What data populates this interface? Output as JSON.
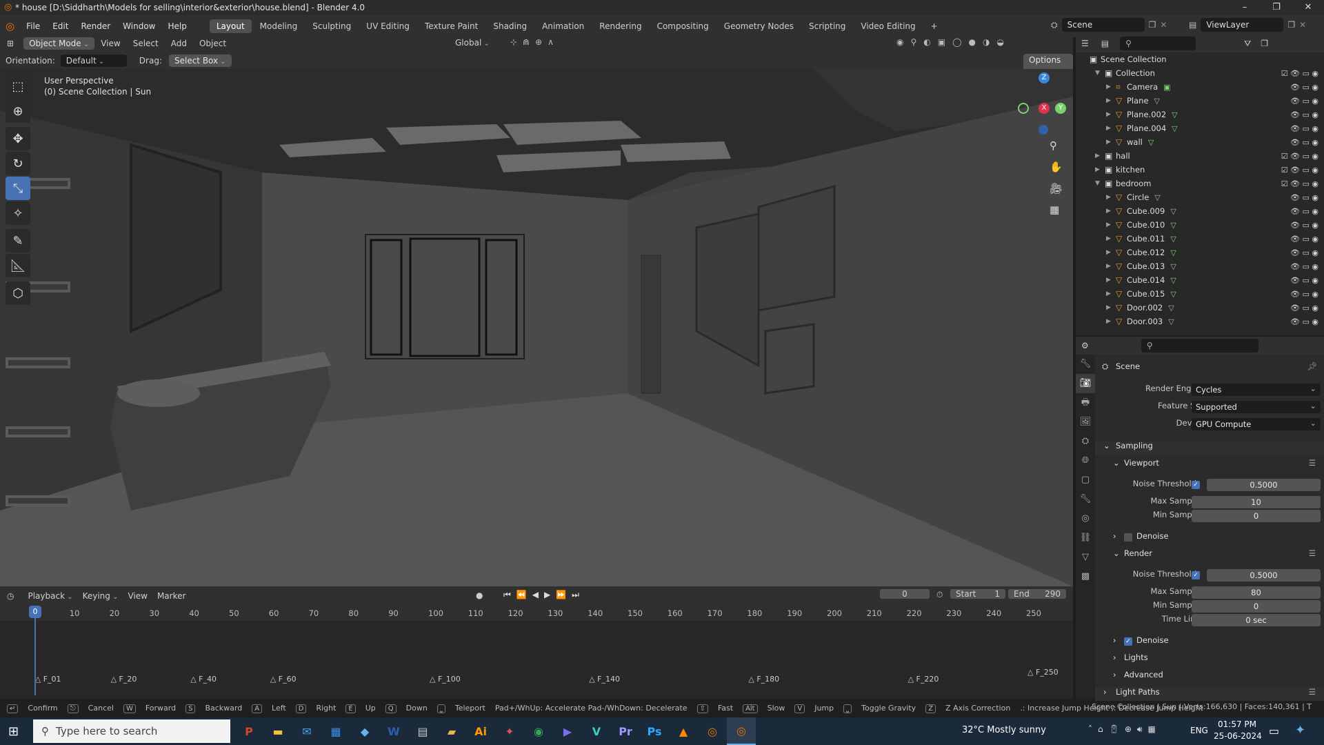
{
  "window": {
    "title": "* house [D:\\Siddharth\\Models for selling\\interior&exterior\\house.blend] - Blender 4.0",
    "controls": [
      "–",
      "❐",
      "✕"
    ]
  },
  "menu": {
    "items": [
      "File",
      "Edit",
      "Render",
      "Window",
      "Help"
    ],
    "workspaces": [
      "Layout",
      "Modeling",
      "Sculpting",
      "UV Editing",
      "Texture Paint",
      "Shading",
      "Animation",
      "Rendering",
      "Compositing",
      "Geometry Nodes",
      "Scripting",
      "Video Editing"
    ],
    "active_workspace": "Layout",
    "plus": "+",
    "scene_name": "Scene",
    "view_layer": "ViewLayer"
  },
  "viewport_header": {
    "mode": "Object Mode",
    "menus": [
      "View",
      "Select",
      "Add",
      "Object"
    ],
    "transform": "Global",
    "orientation_label": "Orientation:",
    "orientation_value": "Default",
    "drag_label": "Drag:",
    "drag_value": "Select Box",
    "options": "Options"
  },
  "viewport": {
    "perspective": "User Perspective",
    "collection_info": "(0) Scene Collection | Sun",
    "gizmo_axes": [
      "Z",
      "X",
      "Y"
    ],
    "colors": {
      "bg": "#3d3d3d",
      "x_axis": "#e0334d",
      "y_axis": "#7bd36f",
      "z_axis": "#3a87e0"
    }
  },
  "timeline": {
    "menus": [
      "Playback",
      "Keying",
      "View",
      "Marker"
    ],
    "current_frame": "0",
    "start_label": "Start",
    "start": "1",
    "end_label": "End",
    "end": "290",
    "ruler": [
      "0",
      "10",
      "20",
      "30",
      "40",
      "50",
      "60",
      "70",
      "80",
      "90",
      "100",
      "110",
      "120",
      "130",
      "140",
      "150",
      "160",
      "170",
      "180",
      "190",
      "200",
      "210",
      "220",
      "230",
      "240",
      "250"
    ],
    "markers": [
      "F_01",
      "F_20",
      "F_40",
      "F_60",
      "F_100",
      "F_140",
      "F_180",
      "F_220",
      "F_250"
    ]
  },
  "statusbar": {
    "hints": [
      {
        "key": "↵",
        "label": "Confirm"
      },
      {
        "key": "⎋",
        "label": "Cancel"
      },
      {
        "key": "W",
        "label": "Forward"
      },
      {
        "key": "S",
        "label": "Backward"
      },
      {
        "key": "A",
        "label": "Left"
      },
      {
        "key": "D",
        "label": "Right"
      },
      {
        "key": "E",
        "label": "Up"
      },
      {
        "key": "Q",
        "label": "Down"
      },
      {
        "key": "⎵",
        "label": "Teleport"
      }
    ],
    "extra": "Pad+/WhUp: Accelerate  Pad-/WhDown: Decelerate",
    "hints2": [
      {
        "key": "⇧",
        "label": "Fast"
      },
      {
        "key": "Alt",
        "label": "Slow"
      },
      {
        "key": "V",
        "label": "Jump"
      },
      {
        "key": "⎵",
        "label": "Toggle Gravity"
      },
      {
        "key": "Z",
        "label": "Z Axis Correction"
      }
    ],
    "jump": ".: Increase Jump Height  ,: Decrease Jump Height",
    "stats": "Scene Collection | Sun | Verts:166,630 | Faces:140,361 | T"
  },
  "outliner": {
    "root": "Scene Collection",
    "rows": [
      {
        "name": "Collection",
        "type": "collection",
        "depth": 1,
        "expanded": true
      },
      {
        "name": "Camera",
        "type": "camera",
        "depth": 2
      },
      {
        "name": "Plane",
        "type": "mesh",
        "depth": 2
      },
      {
        "name": "Plane.002",
        "type": "mesh",
        "depth": 2
      },
      {
        "name": "Plane.004",
        "type": "mesh",
        "depth": 2
      },
      {
        "name": "wall",
        "type": "mesh",
        "depth": 2
      },
      {
        "name": "hall",
        "type": "collection",
        "depth": 1,
        "expanded": false
      },
      {
        "name": "kitchen",
        "type": "collection",
        "depth": 1,
        "expanded": false
      },
      {
        "name": "bedroom",
        "type": "collection",
        "depth": 1,
        "expanded": true
      },
      {
        "name": "Circle",
        "type": "mesh",
        "depth": 2
      },
      {
        "name": "Cube.009",
        "type": "mesh",
        "depth": 2
      },
      {
        "name": "Cube.010",
        "type": "mesh",
        "depth": 2
      },
      {
        "name": "Cube.011",
        "type": "mesh",
        "depth": 2
      },
      {
        "name": "Cube.012",
        "type": "mesh",
        "depth": 2
      },
      {
        "name": "Cube.013",
        "type": "mesh",
        "depth": 2
      },
      {
        "name": "Cube.014",
        "type": "mesh",
        "depth": 2
      },
      {
        "name": "Cube.015",
        "type": "mesh",
        "depth": 2
      },
      {
        "name": "Door.002",
        "type": "mesh",
        "depth": 2
      },
      {
        "name": "Door.003",
        "type": "mesh",
        "depth": 2
      }
    ]
  },
  "properties": {
    "title": "Scene",
    "render_engine_label": "Render Engine",
    "render_engine": "Cycles",
    "feature_set_label": "Feature Set",
    "feature_set": "Supported",
    "device_label": "Device",
    "device": "GPU Compute",
    "sampling": "Sampling",
    "viewport": "Viewport",
    "render": "Render",
    "noise_threshold_label": "Noise Threshold",
    "viewport_noise": "0.5000",
    "max_samples_label": "Max Samples",
    "viewport_max": "10",
    "min_samples_label": "Min Samples",
    "viewport_min": "0",
    "denoise": "Denoise",
    "render_noise": "0.5000",
    "render_max": "80",
    "render_min": "0",
    "time_limit_label": "Time Limit",
    "time_limit": "0 sec",
    "lights": "Lights",
    "advanced": "Advanced",
    "light_paths": "Light Paths"
  },
  "taskbar": {
    "search_placeholder": "Type here to search",
    "weather": "32°C  Mostly sunny",
    "lang": "ENG",
    "time": "01:57 PM",
    "date": "25-06-2024",
    "apps": [
      {
        "name": "powerpoint",
        "glyph": "P",
        "color": "#d24726"
      },
      {
        "name": "file-explorer",
        "glyph": "▬",
        "color": "#f3c13a"
      },
      {
        "name": "mail",
        "glyph": "✉",
        "color": "#4da3e6"
      },
      {
        "name": "store",
        "glyph": "▦",
        "color": "#3b8ee8"
      },
      {
        "name": "app5",
        "glyph": "◆",
        "color": "#6ab0e8"
      },
      {
        "name": "word",
        "glyph": "W",
        "color": "#2b5fb4"
      },
      {
        "name": "app7",
        "glyph": "▤",
        "color": "#c6c6c6"
      },
      {
        "name": "app8",
        "glyph": "▰",
        "color": "#e8b94a"
      },
      {
        "name": "illustrator",
        "glyph": "Ai",
        "color": "#ff9a00"
      },
      {
        "name": "app10",
        "glyph": "✦",
        "color": "#e05050"
      },
      {
        "name": "chrome",
        "glyph": "◉",
        "color": "#34a853"
      },
      {
        "name": "app12",
        "glyph": "▶",
        "color": "#7b6cf0"
      },
      {
        "name": "app13",
        "glyph": "V",
        "color": "#3bd0c4"
      },
      {
        "name": "premiere",
        "glyph": "Pr",
        "color": "#9999ff"
      },
      {
        "name": "photoshop",
        "glyph": "Ps",
        "color": "#31a8ff"
      },
      {
        "name": "vlc",
        "glyph": "▲",
        "color": "#ff8800"
      },
      {
        "name": "blender",
        "glyph": "◎",
        "color": "#ea7600"
      },
      {
        "name": "blender-active",
        "glyph": "◎",
        "color": "#ea7600"
      }
    ]
  }
}
